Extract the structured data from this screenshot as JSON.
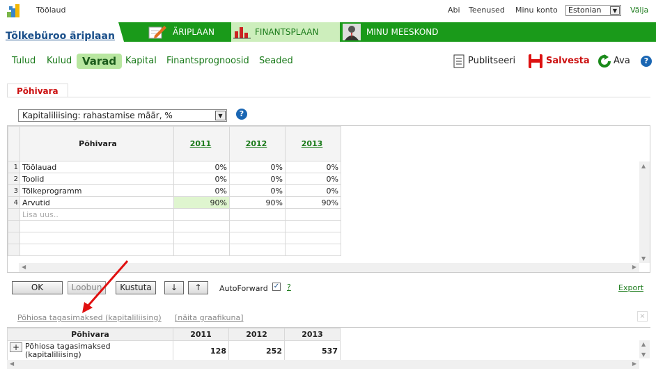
{
  "header": {
    "app_link": "Töölaud",
    "links": [
      "Abi",
      "Teenused",
      "Minu konto"
    ],
    "language": "Estonian",
    "logout": "Välja"
  },
  "plan_title": "Tõlkebüroo äriplaan",
  "module_tabs": [
    {
      "label": "ÄRIPLAAN",
      "icon": "pencil-doc-icon"
    },
    {
      "label": "FINANTSPLAAN",
      "icon": "bar-chart-icon",
      "active": true
    },
    {
      "label": "MINU MEESKOND",
      "icon": "person-icon"
    }
  ],
  "subnav": [
    "Tulud",
    "Kulud",
    "Varad",
    "Kapital",
    "Finantsprognoosid",
    "Seaded"
  ],
  "subnav_active": "Varad",
  "tools": {
    "publish": "Publitseeri",
    "save": "Salvesta",
    "open": "Ava"
  },
  "panel_tab": "Põhivara",
  "dropdown": {
    "value": "Kapitaliliising: rahastamise määr, %"
  },
  "grid": {
    "column_header": "Põhivara",
    "years": [
      "2011",
      "2012",
      "2013"
    ],
    "rows": [
      {
        "n": "1",
        "name": "Töölauad",
        "values": [
          "0%",
          "0%",
          "0%"
        ]
      },
      {
        "n": "2",
        "name": "Toolid",
        "values": [
          "0%",
          "0%",
          "0%"
        ]
      },
      {
        "n": "3",
        "name": "Tõlkeprogramm",
        "values": [
          "0%",
          "0%",
          "0%"
        ]
      },
      {
        "n": "4",
        "name": "Arvutid",
        "values": [
          "90%",
          "90%",
          "90%"
        ]
      }
    ],
    "add_placeholder": "Lisa uus.."
  },
  "buttons": {
    "ok": "OK",
    "cancel": "Loobun",
    "delete": "Kustuta",
    "down": "↓",
    "up": "↑",
    "autoforward": "AutoForward",
    "help": "?",
    "export": "Export"
  },
  "lower": {
    "link": "Põhiosa tagasimaksed (kapitaliliising)",
    "graph_link": "[näita graafikuna]",
    "table_header": "Põhivara",
    "years": [
      "2011",
      "2012",
      "2013"
    ],
    "row_label": "Põhiosa tagasimaksed (kapitaliliising)",
    "values": [
      "128",
      "252",
      "537"
    ]
  },
  "colors": {
    "brand_green": "#1a9a1a",
    "active_tab_bg": "#cdeebc",
    "accent_red": "#cc1111",
    "link_blue": "#1a4f8a"
  }
}
